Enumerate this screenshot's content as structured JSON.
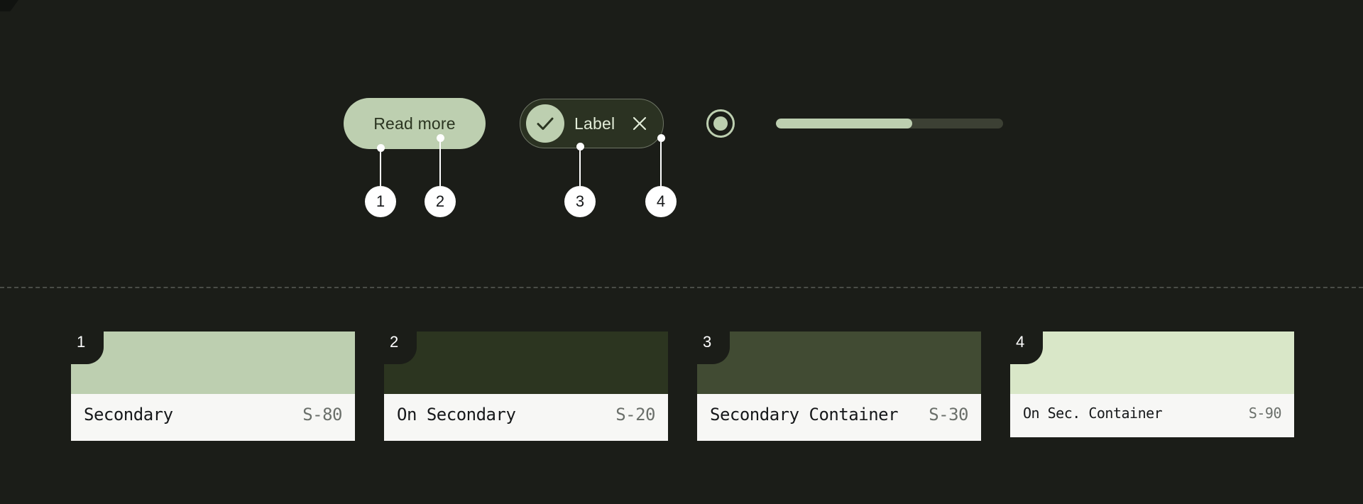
{
  "theme": {
    "background": "#1b1d18",
    "accent": "#bdcfb0",
    "on_accent": "#2b3521",
    "callout_fill": "#ffffff",
    "card_info_bg": "#f7f7f5"
  },
  "demo": {
    "button": {
      "label": "Read more",
      "fill": "#bdcfb0",
      "text_color": "#2b3521"
    },
    "chip": {
      "label": "Label",
      "leading_icon": "check-icon",
      "trailing_icon": "close-icon",
      "fill": "#2b3222",
      "border": "#6e7565",
      "avatar_fill": "#bdcfb0"
    },
    "radio": {
      "state": "selected",
      "color": "#bdcfb0"
    },
    "progress": {
      "value_percent": 60,
      "fill": "#bdcfb0",
      "track": "#3c4034"
    }
  },
  "callouts": [
    {
      "number": "1",
      "line_height": 48
    },
    {
      "number": "2",
      "line_height": 62
    },
    {
      "number": "3",
      "line_height": 50
    },
    {
      "number": "4",
      "line_height": 62
    }
  ],
  "swatch_cards": [
    {
      "badge": "1",
      "name": "Secondary",
      "token": "S-80",
      "color": "#bdcfb0",
      "small": false
    },
    {
      "badge": "2",
      "name": "On Secondary",
      "token": "S-20",
      "color": "#2c3520",
      "small": false
    },
    {
      "badge": "3",
      "name": "Secondary Container",
      "token": "S-30",
      "color": "#414b33",
      "small": false
    },
    {
      "badge": "4",
      "name": "On Sec. Container",
      "token": "S-90",
      "color": "#d9e7c8",
      "small": true
    }
  ]
}
